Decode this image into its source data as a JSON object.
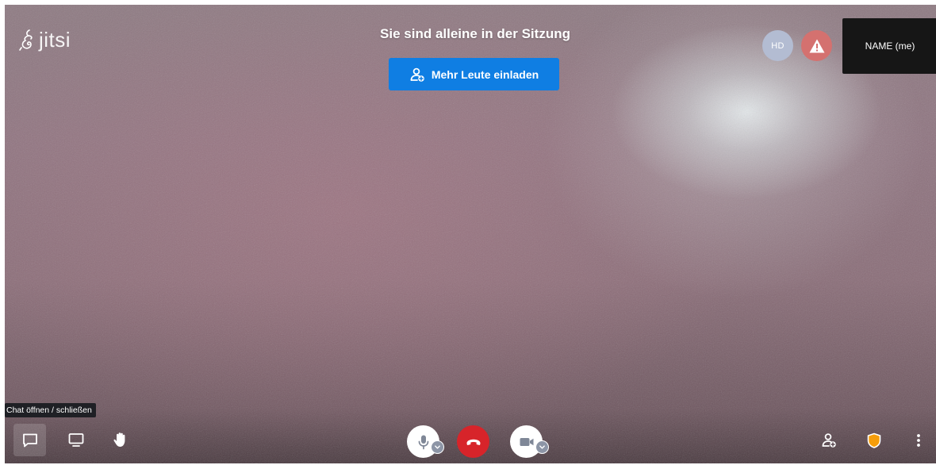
{
  "app": {
    "logo_text": "jitsi",
    "title": "Sie sind alleine in der Sitzung",
    "invite_label": "Mehr Leute einladen"
  },
  "participants": {
    "avatar_initials": "HD",
    "self_name": "NAME (me)"
  },
  "toolbar": {
    "tooltip": "Chat öffnen / schließen",
    "left_buttons": [
      "chat-icon",
      "screen-share-icon",
      "raise-hand-icon"
    ],
    "center_buttons": [
      "microphone-icon",
      "hangup-icon",
      "camera-icon"
    ],
    "right_buttons": [
      "invite-icon",
      "security-shield-icon",
      "more-vertical-icon"
    ]
  },
  "colors": {
    "invite_button": "#0f7ee3",
    "hangup": "#d7242a",
    "warning_avatar": "#d4716f",
    "security_shield": "#f59d0a",
    "hd_avatar": "#b3bcd2"
  }
}
